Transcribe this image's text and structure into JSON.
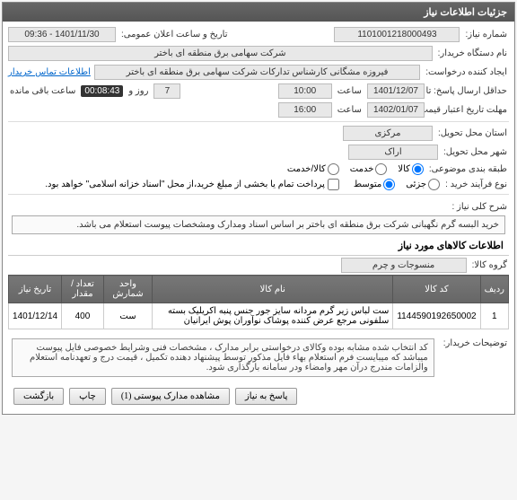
{
  "header": {
    "title": "جزئیات اطلاعات نیاز"
  },
  "fields": {
    "need_number_label": "شماره نیاز:",
    "need_number": "1101001218000493",
    "announce_label": "تاریخ و ساعت اعلان عمومی:",
    "announce_value": "1401/11/30 - 09:36",
    "buyer_label": "نام دستگاه خریدار:",
    "buyer": "شرکت سهامی برق منطقه ای باختر",
    "creator_label": "ایجاد کننده درخواست:",
    "creator": "فیروزه مشگانی کارشناس تدارکات شرکت سهامی برق منطقه ای باختر",
    "contact_link": "اطلاعات تماس خریدار",
    "deadline_label": "حداقل ارسال پاسخ: تا تاریخ:",
    "deadline_date": "1401/12/07",
    "deadline_time_label": "ساعت",
    "deadline_time": "10:00",
    "day_label": "روز و",
    "day_value": "7",
    "remaining_label": "ساعت باقی مانده",
    "remaining_time": "00:08:43",
    "validity_label": "مهلت تاریخ اعتبار قیمت: تا تاریخ:",
    "validity_date": "1402/01/07",
    "validity_time": "16:00",
    "province_label": "استان محل تحویل:",
    "province": "مرکزی",
    "city_label": "شهر محل تحویل:",
    "city": "اراک",
    "category_label": "طبقه بندی موضوعی:",
    "cat_goods": "کالا",
    "cat_service": "خدمت",
    "cat_both": "کالا/خدمت",
    "process_label": "نوع فرآیند خرید :",
    "proc_small": "جزئی",
    "proc_medium": "متوسط",
    "payment_note": "پرداخت تمام یا بخشی از مبلغ خرید،از محل \"اسناد خزانه اسلامی\" خواهد بود.",
    "need_desc_label": "شرح کلی نیاز :",
    "need_desc": "خرید البسه گرم نگهبانی شرکت برق منطقه ای باختر بر اساس اسناد ومدارک ومشخصات پیوست استعلام می باشد.",
    "goods_info_title": "اطلاعات کالاهای مورد نیاز",
    "goods_group_label": "گروه کالا:",
    "goods_group": "منسوجات و چرم",
    "buyer_notes_label": "توضیحات خریدار:",
    "buyer_notes": "کد انتخاب شده مشابه بوده وکالای درخواستی برابر مدارک ، مشخصات فنی وشرایط خصوصی فایل پیوست میباشد که میبایست فرم استعلام بهاء فایل مذکور توسط پیشنهاد دهنده تکمیل ، قیمت درج و تعهدنامه استعلام والزامات  مندرج درآن مهر وامضاء ودر سامانه بارگذاری شود."
  },
  "table": {
    "headers": {
      "row": "ردیف",
      "code": "کد کالا",
      "name": "نام کالا",
      "unit": "واحد شمارش",
      "qty": "تعداد / مقدار",
      "date": "تاریخ نیاز"
    },
    "rows": [
      {
        "idx": "1",
        "code": "1144590192650002",
        "name": "ست لباس زیر گرم مردانه سایز جور جنس پنبه اکریلیک بسته سلفونی مرجع عرض کننده پوشاک نوآوران پوش ایرانیان",
        "unit": "ست",
        "qty": "400",
        "date": "1401/12/14"
      }
    ]
  },
  "buttons": {
    "reply": "پاسخ به نیاز",
    "attachments": "مشاهده مدارک پیوستی (1)",
    "print": "چاپ",
    "back": "بازگشت"
  }
}
